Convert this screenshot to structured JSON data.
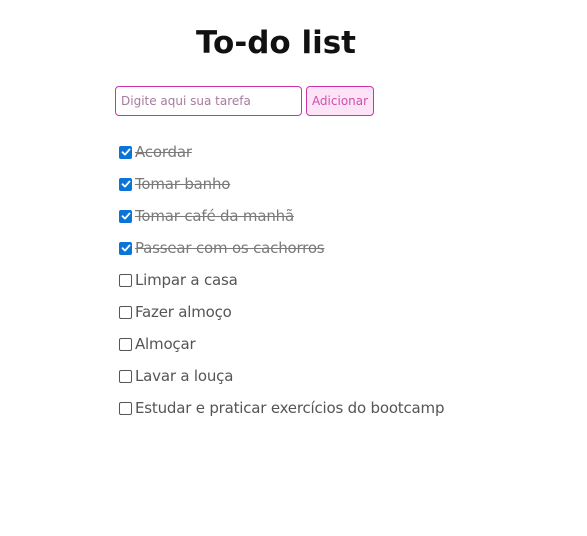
{
  "page": {
    "title": "To-do list"
  },
  "form": {
    "input_value": "",
    "input_placeholder": "Digite aqui sua tarefa",
    "add_label": "Adicionar"
  },
  "colors": {
    "accent_border": "#cc33aa",
    "button_bg": "#fde3f6",
    "button_text": "#d04fae",
    "checkbox_checked": "#0b74d7"
  },
  "tasks": [
    {
      "label": "Acordar",
      "done": true
    },
    {
      "label": "Tomar banho",
      "done": true
    },
    {
      "label": "Tomar café da manhã",
      "done": true
    },
    {
      "label": "Passear com os cachorros",
      "done": true
    },
    {
      "label": "Limpar a casa",
      "done": false
    },
    {
      "label": "Fazer almoço",
      "done": false
    },
    {
      "label": "Almoçar",
      "done": false
    },
    {
      "label": "Lavar a louça",
      "done": false
    },
    {
      "label": "Estudar e praticar exercícios do bootcamp",
      "done": false
    }
  ]
}
